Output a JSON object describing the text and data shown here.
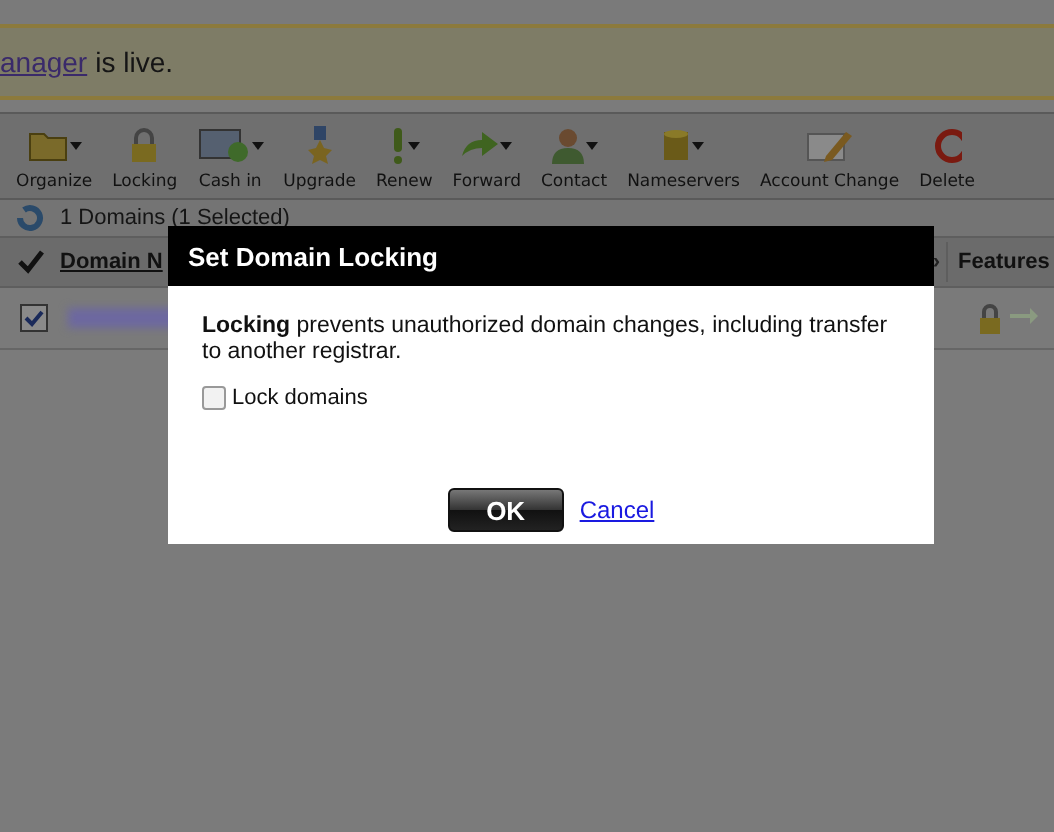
{
  "banner": {
    "link": "anager",
    "text": "is live."
  },
  "toolbar": [
    {
      "label": "Organize",
      "dropdown": true
    },
    {
      "label": "Locking",
      "dropdown": false
    },
    {
      "label": "Cash in",
      "dropdown": true
    },
    {
      "label": "Upgrade",
      "dropdown": false
    },
    {
      "label": "Renew",
      "dropdown": true
    },
    {
      "label": "Forward",
      "dropdown": true
    },
    {
      "label": "Contact",
      "dropdown": true
    },
    {
      "label": "Nameservers",
      "dropdown": true
    },
    {
      "label": "Account Change",
      "dropdown": false
    },
    {
      "label": "Delete",
      "dropdown": false
    }
  ],
  "summary": "1 Domains (1 Selected)",
  "table": {
    "columns": [
      {
        "label": "Domain N"
      },
      {
        "label": "Features"
      }
    ],
    "scroll_arrow": "›",
    "rows": [
      {
        "selected": true
      }
    ]
  },
  "dialog": {
    "title": "Set Domain Locking",
    "message": "**Locking** prevents unauthorized domain changes, including transfer to another registrar.",
    "checkbox": {
      "label": "Lock domains",
      "checked": false
    },
    "ok": "OK",
    "cancel": "Cancel"
  }
}
